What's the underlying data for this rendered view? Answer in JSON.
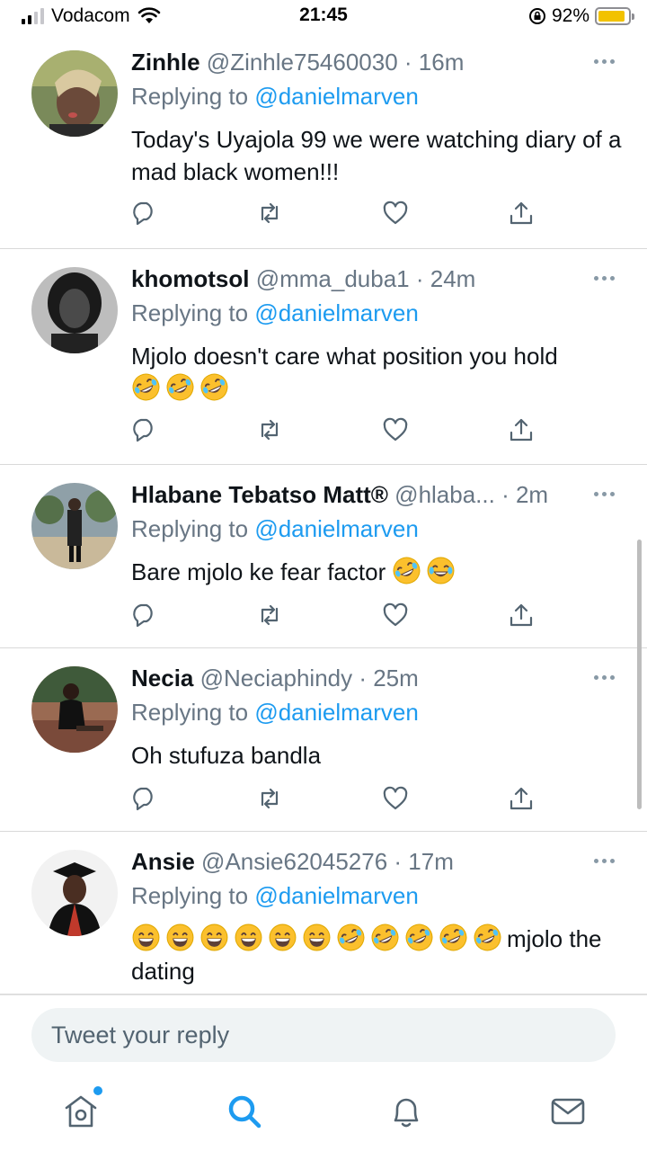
{
  "status_bar": {
    "carrier": "Vodacom",
    "time": "21:45",
    "battery_percent": "92%",
    "battery_level": 0.92,
    "battery_color": "#f2c200"
  },
  "accent_color": "#1d9bf0",
  "tweets": [
    {
      "name": "Zinhle",
      "handle": "@Zinhle75460030",
      "time": "16m",
      "replying_prefix": "Replying to",
      "replying_to": "@danielmarven",
      "text": "Today's Uyajola 99 we were watching diary of a mad black women!!!"
    },
    {
      "name": "khomotsol",
      "handle": "@mma_duba1",
      "time": "24m",
      "replying_prefix": "Replying to",
      "replying_to": "@danielmarven",
      "text": "Mjolo doesn't care what position you hold",
      "emojis": [
        "rofl",
        "rofl",
        "rofl"
      ]
    },
    {
      "name": "Hlabane Tebatso Matt®",
      "handle": "@hlaba...",
      "time": "2m",
      "replying_prefix": "Replying to",
      "replying_to": "@danielmarven",
      "text": "Bare mjolo ke fear factor",
      "emojis": [
        "rofl",
        "joy"
      ]
    },
    {
      "name": "Necia",
      "handle": "@Neciaphindy",
      "time": "25m",
      "replying_prefix": "Replying to",
      "replying_to": "@danielmarven",
      "text": "Oh stufuza bandla"
    },
    {
      "name": "Ansie",
      "handle": "@Ansie62045276",
      "time": "17m",
      "replying_prefix": "Replying to",
      "replying_to": "@danielmarven",
      "emojis": [
        "grin",
        "grin",
        "grin",
        "grin",
        "grin",
        "grin",
        "rofl",
        "rofl",
        "rofl",
        "rofl",
        "rofl"
      ],
      "text": "mjolo the dating"
    }
  ],
  "reply_box": {
    "placeholder": "Tweet your reply"
  },
  "tabbar": {
    "items": [
      "home-icon",
      "search-icon",
      "bell-icon",
      "mail-icon"
    ],
    "active": "search-icon"
  }
}
